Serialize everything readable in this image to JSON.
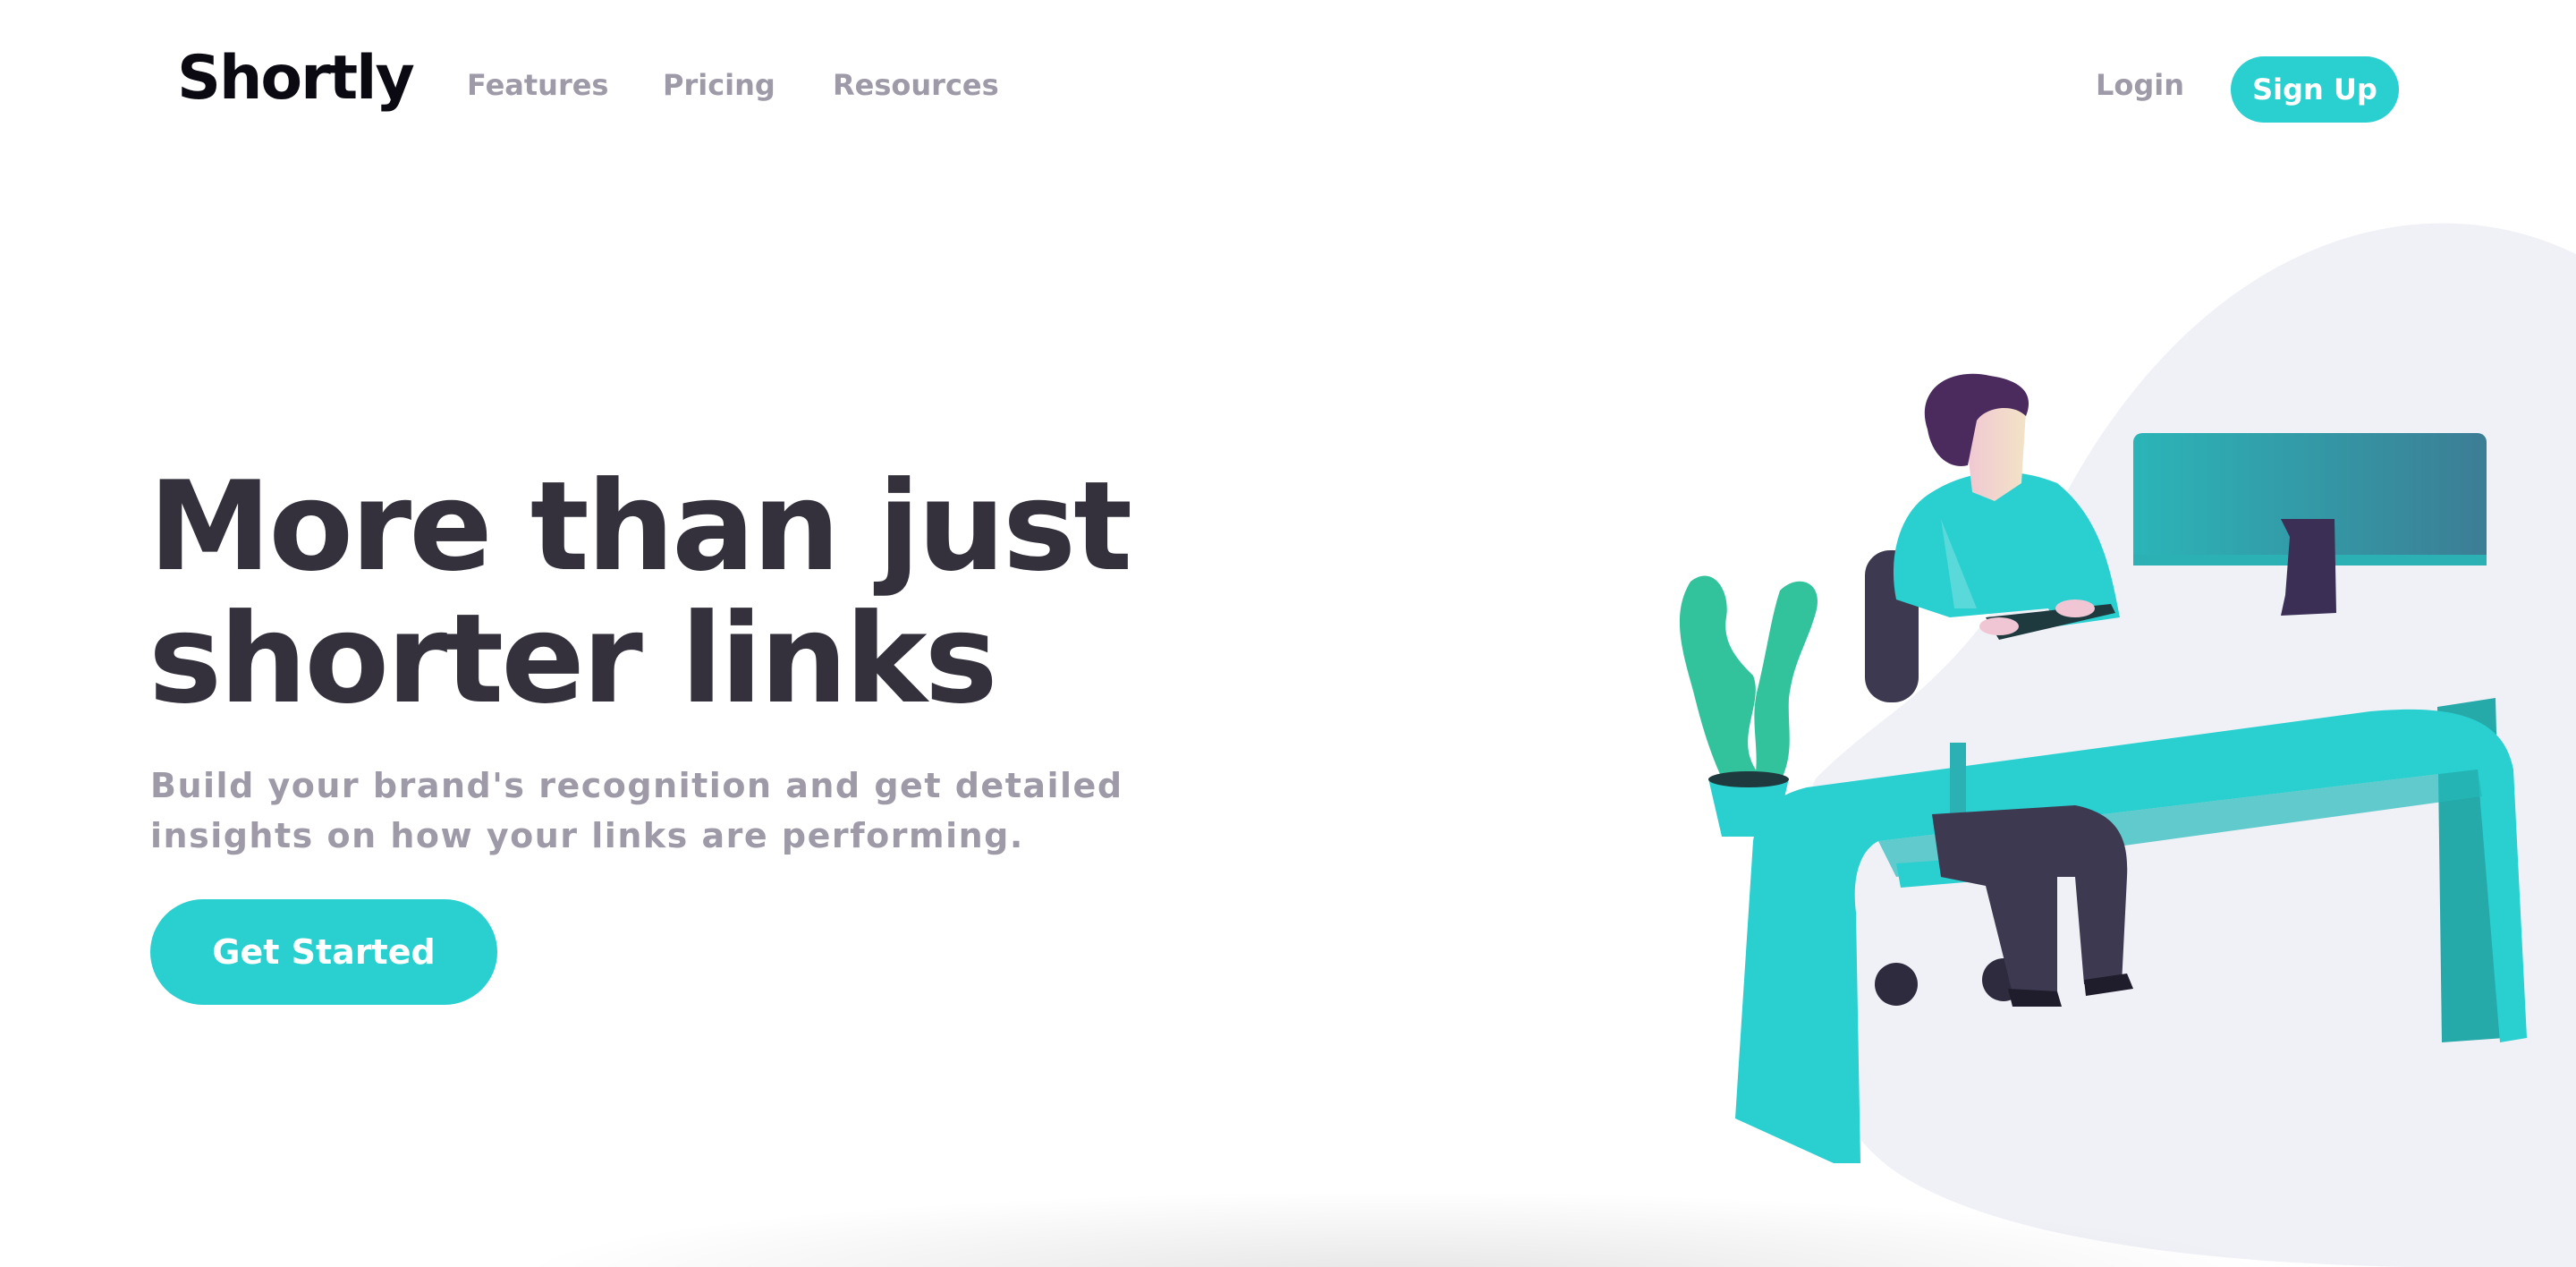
{
  "brand": {
    "logo": "Shortly",
    "accent": "#2acfcf",
    "dark": "#34313d",
    "gray": "#9e9aa8"
  },
  "nav": {
    "links": [
      "Features",
      "Pricing",
      "Resources"
    ],
    "login": "Login",
    "signup": "Sign Up"
  },
  "hero": {
    "title_line1": "More than just",
    "title_line2": "shorter links",
    "desc_line1": "Build your brand's recognition and get detailed",
    "desc_line2": "insights on how your links are performing.",
    "cta": "Get Started"
  },
  "illustration": {
    "name": "person-working-at-desk-illustration"
  }
}
